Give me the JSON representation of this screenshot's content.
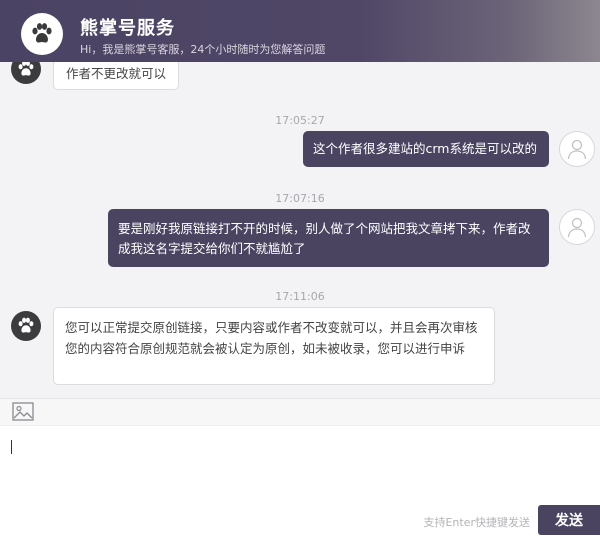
{
  "header": {
    "title": "熊掌号服务",
    "subtitle": "Hi，我是熊掌号客服，24个小时随时为您解答问题"
  },
  "messages": [
    {
      "side": "left",
      "text": "作者不更改就可以"
    },
    {
      "side": "right",
      "time": "17:05:27",
      "text": "这个作者很多建站的crm系统是可以改的"
    },
    {
      "side": "right",
      "time": "17:07:16",
      "text": "要是刚好我原链接打不开的时候，别人做了个网站把我文章拷下来，作者改成我这名字提交给你们不就尴尬了"
    },
    {
      "side": "left",
      "time": "17:11:06",
      "text": "您可以正常提交原创链接，只要内容或作者不改变就可以，并且会再次审核您的内容符合原创规范就会被认定为原创，如未被收录，您可以进行申诉"
    }
  ],
  "composer": {
    "hint": "支持Enter快捷键发送",
    "send_label": "发送"
  },
  "colors": {
    "header_bg": "#4b4363",
    "user_bubble": "#4a4461",
    "chat_bg": "#f3f3f5"
  },
  "icons": [
    "paw-icon",
    "user-avatar-icon",
    "image-icon"
  ]
}
